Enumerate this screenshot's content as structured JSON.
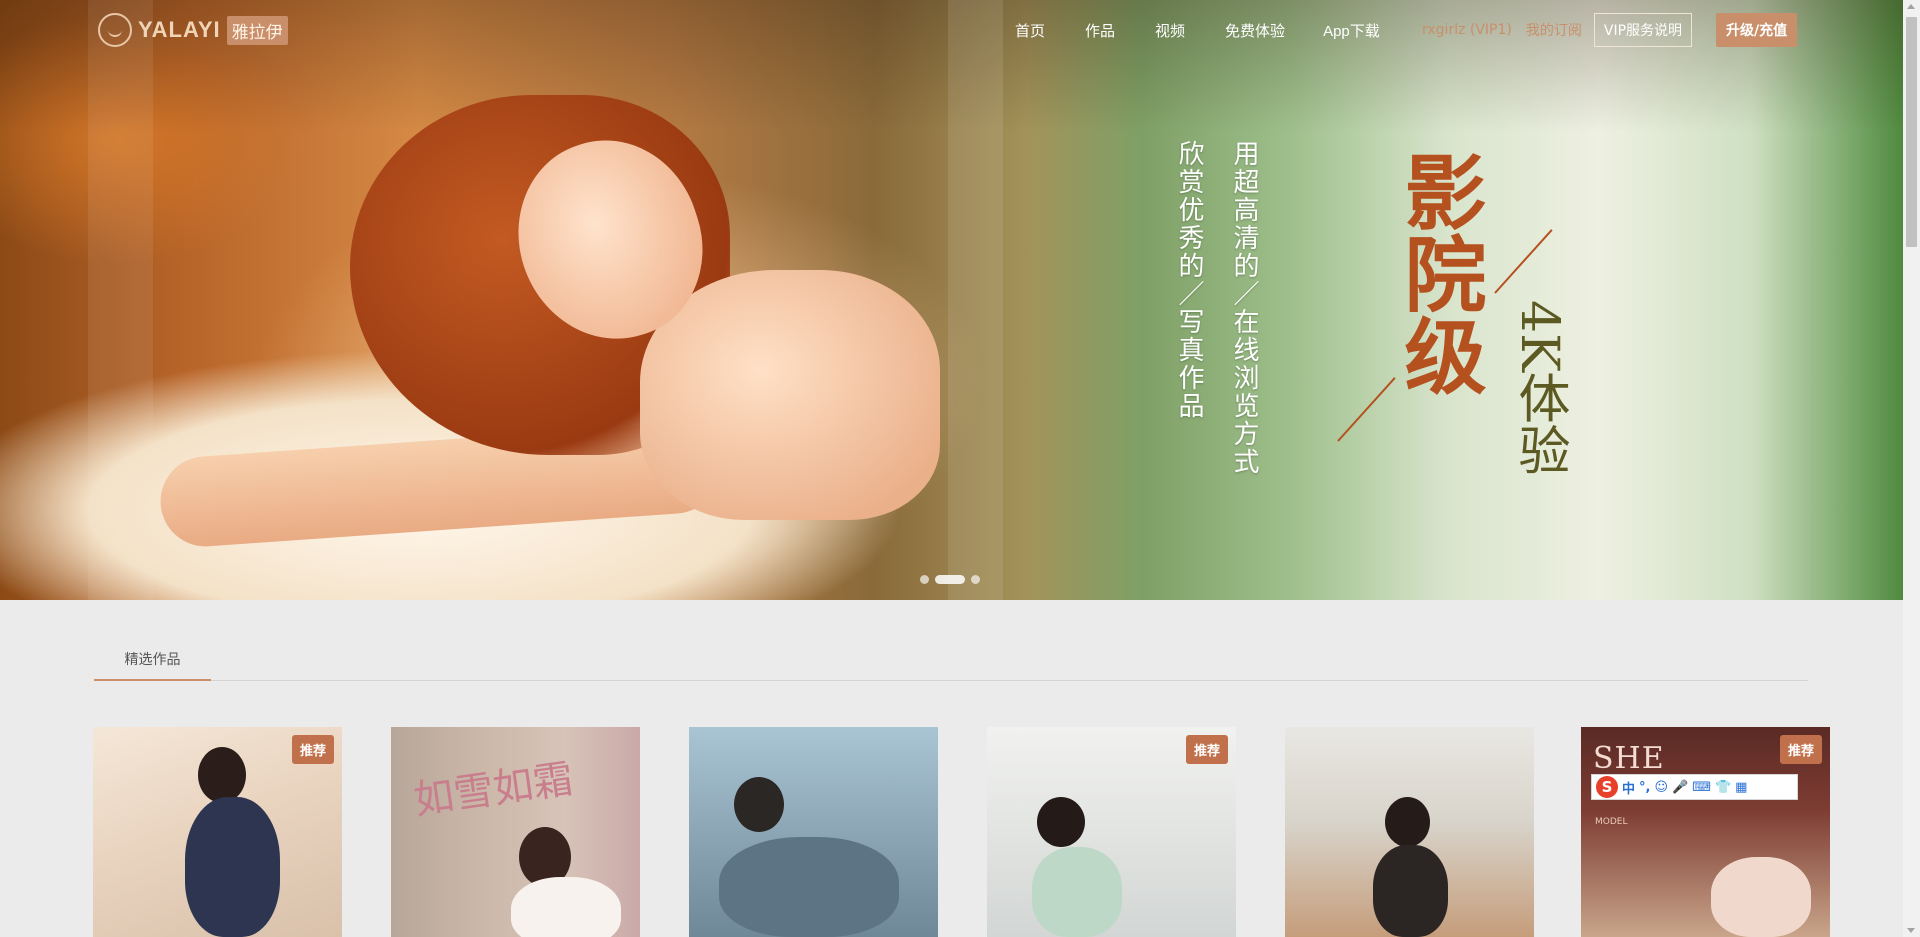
{
  "header": {
    "logo_text": "YALAYI",
    "logo_badge": "雅拉伊",
    "nav": [
      "首页",
      "作品",
      "视频",
      "免费体验",
      "App下载"
    ],
    "user_name": "rxgirlz (VIP1)",
    "my_subscription": "我的订阅",
    "vip_info_button": "VIP服务说明",
    "upgrade_button": "升级/充值"
  },
  "hero": {
    "poem_line_1": "用超高清的／在线浏览方式",
    "poem_line_2": "欣赏优秀的／写真作品",
    "slogan": "影院级",
    "slogan_sub": "4K体验",
    "carousel": {
      "slide_count": 3,
      "active_index": 1
    }
  },
  "featured": {
    "tab_label": "精选作品",
    "cards": [
      {
        "badge": "推荐"
      },
      {
        "badge": "",
        "overlay_text": "如雪如霜"
      },
      {
        "badge": ""
      },
      {
        "badge": "推荐"
      },
      {
        "badge": ""
      },
      {
        "badge": "推荐",
        "overlay_text": "SHE",
        "overlay_sub": "MODEL"
      }
    ]
  },
  "ime_toolbar": {
    "logo": "S",
    "mode": "中",
    "items": [
      "°,",
      "☺",
      "🎤",
      "⌨",
      "👕",
      "▦"
    ]
  },
  "colors": {
    "accent": "#c98f6a",
    "badge": "#c0704a",
    "page_bg": "#ebebeb"
  }
}
